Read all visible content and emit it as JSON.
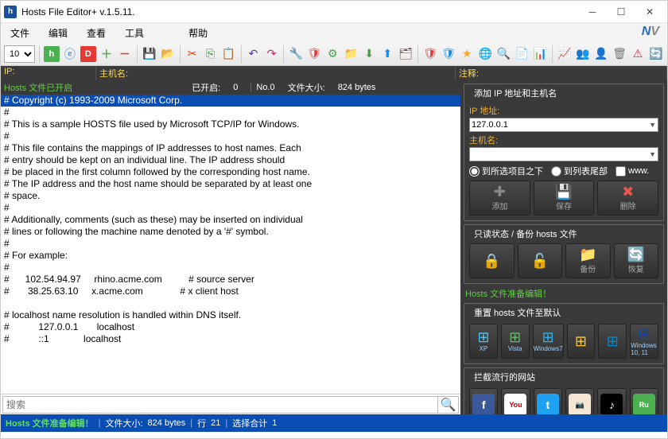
{
  "titlebar": {
    "title": "Hosts File Editor+ v.1.5.11."
  },
  "menu": {
    "file": "文件",
    "edit": "编辑",
    "view": "查看",
    "tools": "工具",
    "help": "帮助"
  },
  "toolbar": {
    "fontsize": "10"
  },
  "columns": {
    "ip": "IP:",
    "host": "主机名:",
    "comment": "注释:"
  },
  "topline": {
    "opened": "Hosts 文件已开启",
    "opencount_label": "已开启:",
    "opencount": "0",
    "no": "No.0",
    "size_label": "文件大小:",
    "size": "824 bytes"
  },
  "editor_lines": [
    "# Copyright (c) 1993-2009 Microsoft Corp.",
    "#",
    "# This is a sample HOSTS file used by Microsoft TCP/IP for Windows.",
    "#",
    "# This file contains the mappings of IP addresses to host names. Each",
    "# entry should be kept on an individual line. The IP address should",
    "# be placed in the first column followed by the corresponding host name.",
    "# The IP address and the host name should be separated by at least one",
    "# space.",
    "#",
    "# Additionally, comments (such as these) may be inserted on individual",
    "# lines or following the machine name denoted by a '#' symbol.",
    "#",
    "# For example:",
    "#",
    "#      102.54.94.97     rhino.acme.com          # source server",
    "#       38.25.63.10     x.acme.com              # x client host",
    "",
    "# localhost name resolution is handled within DNS itself.",
    "#           127.0.0.1       localhost",
    "#           ::1             localhost"
  ],
  "search": {
    "placeholder": "搜索"
  },
  "panel_add": {
    "title": "添加 IP 地址和主机名",
    "ip_label": "IP 地址:",
    "ip_value": "127.0.0.1",
    "host_label": "主机名:",
    "host_value": "",
    "opt1": "到所选项目之下",
    "opt2": "到列表尾部",
    "opt3": "www.",
    "add": "添加",
    "save": "保存",
    "delete": "删除"
  },
  "panel_lock": {
    "title": "只读状态 / 备份 hosts 文件",
    "backup": "备份",
    "restore": "恢复"
  },
  "readytext": "Hosts 文件准备编辑！",
  "panel_reset": {
    "title": "重置 hosts 文件至默认",
    "os": [
      {
        "label": "XP"
      },
      {
        "label": "Vista"
      },
      {
        "label": "Windows7"
      },
      {
        "label": ""
      },
      {
        "label": ""
      },
      {
        "label": "Windows 10, 11"
      }
    ]
  },
  "panel_block": {
    "title": "拦截流行的网站",
    "sites": [
      {
        "name": "facebook",
        "letter": "f",
        "bg": "#3b5998"
      },
      {
        "name": "youtube",
        "letter": "You",
        "bg": "#ffffff"
      },
      {
        "name": "twitter",
        "letter": "t",
        "bg": "#1da1f2"
      },
      {
        "name": "instagram",
        "letter": "📷",
        "bg": "#f5e7d3"
      },
      {
        "name": "tiktok",
        "letter": "♪",
        "bg": "#000000"
      },
      {
        "name": "rutracker",
        "letter": "Ru",
        "bg": "#4caf50"
      }
    ]
  },
  "status": {
    "ready": "Hosts 文件准备编辑！",
    "size_label": "文件大小:",
    "size": "824 bytes",
    "line_label": "行",
    "line": "21",
    "sel_label": "选择合计",
    "sel": "1"
  }
}
